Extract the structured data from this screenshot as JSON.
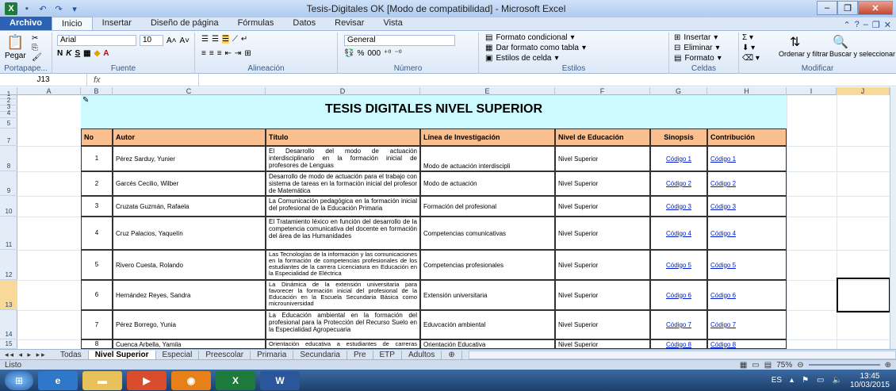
{
  "window": {
    "title": "Tesis-Digitales OK  [Modo de compatibilidad]  -  Microsoft Excel",
    "app_icon": "X"
  },
  "ribbon_tabs": [
    "Archivo",
    "Inicio",
    "Insertar",
    "Diseño de página",
    "Fórmulas",
    "Datos",
    "Revisar",
    "Vista"
  ],
  "ribbon": {
    "clipboard": {
      "paste": "Pegar",
      "label": "Portapape..."
    },
    "font": {
      "name": "Arial",
      "size": "10",
      "label": "Fuente"
    },
    "alignment": {
      "label": "Alineación"
    },
    "number": {
      "format": "General",
      "pct": "%",
      "thousands": "000",
      "label": "Número"
    },
    "styles": {
      "conditional": "Formato condicional",
      "table": "Dar formato como tabla",
      "cell": "Estilos de celda",
      "label": "Estilos"
    },
    "cells": {
      "insert": "Insertar",
      "delete": "Eliminar",
      "format": "Formato",
      "label": "Celdas"
    },
    "modify": {
      "sort": "Ordenar y filtrar",
      "find": "Buscar y seleccionar",
      "label": "Modificar"
    }
  },
  "formula_bar": {
    "cell_ref": "J13",
    "fx": "fx",
    "content": ""
  },
  "columns": [
    "A",
    "B",
    "C",
    "D",
    "E",
    "F",
    "G",
    "H",
    "I",
    "J"
  ],
  "rows": [
    "1",
    "2",
    "3",
    "4",
    "5",
    "7",
    "8",
    "9",
    "10",
    "11",
    "12",
    "13",
    "14",
    "15"
  ],
  "sheet": {
    "title": "TESIS DIGITALES NIVEL SUPERIOR",
    "headers": {
      "no": "No",
      "autor": "Autor",
      "titulo": "Título",
      "linea": "Línea de Investigación",
      "nivel": "Nivel de Educación",
      "sinopsis": "Sinopsis",
      "contribucion": "Contribución"
    },
    "records": [
      {
        "no": "1",
        "autor": "Pérez Sarduy, Yunier",
        "titulo": "El Desarrollo del modo de actuación interdisciplinario en la formación inicial de profesores de Lenguas",
        "linea": "Modo de actuación interdiscipli",
        "nivel": "Nivel Superior",
        "sinopsis": "Código 1",
        "contribucion": "Código 1"
      },
      {
        "no": "2",
        "autor": "Garcés Cecilio, Wilber",
        "titulo": "Desarrollo de modo de actuación para el trabajo con sistema de tareas en la formación inicial del profesor de Matemática",
        "linea": "Modo de actuación",
        "nivel": "Nivel Superior",
        "sinopsis": "Código 2",
        "contribucion": "Código 2"
      },
      {
        "no": "3",
        "autor": "Cruzata Guzmán, Rafaela",
        "titulo": "La Comunicación pedagógica en la formación inicial del profesional de la Educación Primaria",
        "linea": "Formación del profesional",
        "nivel": "Nivel Superior",
        "sinopsis": "Código 3",
        "contribucion": "Código 3"
      },
      {
        "no": "4",
        "autor": "Cruz Palacios, Yaquelín",
        "titulo": "El Tratamiento léxico en función del desarrollo de la competencia comunicativa del docente en formación del área de las Humanidades",
        "linea": "Competencias comunicativas",
        "nivel": "Nivel Superior",
        "sinopsis": "Código 4",
        "contribucion": "Código 4"
      },
      {
        "no": "5",
        "autor": "Rivero Cuesta, Rolando",
        "titulo": "Las Tecnologías de la información y las comunicaciones en la formación de competencias profesionales de los estudiantes de la carrera Licenciatura en Educación en la Especialidad de Eléctrica",
        "linea": "Competencias profesionales",
        "nivel": "Nivel Superior",
        "sinopsis": "Código 5",
        "contribucion": "Código 5"
      },
      {
        "no": "6",
        "autor": "Hernández Reyes, Sandra",
        "titulo": "La Dinámica de la extensión universitaria para favorecer la formación inicial del profesional de la Educación en la Escuela Secundaria Básica como microuniversidad",
        "linea": "Extensión universitaria",
        "nivel": "Nivel Superior",
        "sinopsis": "Código 6",
        "contribucion": "Código 6"
      },
      {
        "no": "7",
        "autor": "Pérez Borrego, Yunia",
        "titulo": "La Educación ambiental en la formación del profesional para la Protección del Recurso Suelo en la Especialidad Agropecuaria",
        "linea": "Eduvcación ambiental",
        "nivel": "Nivel Superior",
        "sinopsis": "Código 7",
        "contribucion": "Código 7"
      },
      {
        "no": "8",
        "autor": "Cuenca Arbella, Yamila",
        "titulo": "Orientación educativa a estudiantes de carreras pedagógicas para el",
        "linea": "Orientación Educativa",
        "nivel": "Nivel Superior",
        "sinopsis": "Código 8",
        "contribucion": "Código 8"
      }
    ]
  },
  "sheet_tabs": [
    "Todas",
    "Nivel Superior",
    "Especial",
    "Preescolar",
    "Primaria",
    "Secundaria",
    "Pre",
    "ETP",
    "Adultos"
  ],
  "status": {
    "ready": "Listo",
    "zoom": "75%"
  },
  "taskbar": {
    "lang": "ES",
    "time": "13:45",
    "date": "10/03/2015"
  },
  "colors": {
    "banner": "#ccfafe",
    "header": "#fabf8f",
    "link": "#0020d0",
    "selected_header": "#f9d99a"
  }
}
